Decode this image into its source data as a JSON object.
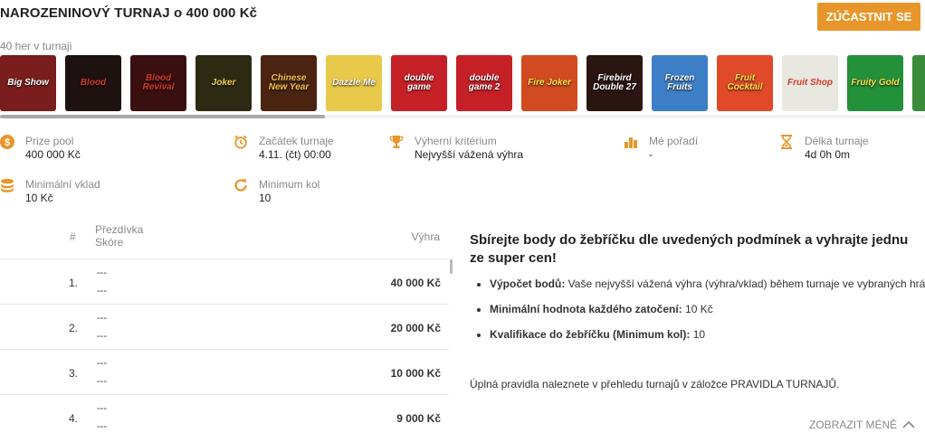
{
  "header": {
    "title": "NAROZENINOVÝ TURNAJ o 400 000 Kč",
    "join_label": "ZÚČASTNIT SE",
    "games_count": "40 her v turnaji"
  },
  "games": [
    {
      "name": "Big Show",
      "color": "#7a1d1d"
    },
    {
      "name": "Blood",
      "color": "#1e1210"
    },
    {
      "name": "Blood Revival",
      "color": "#3a0f10"
    },
    {
      "name": "Joker",
      "color": "#2c2a12"
    },
    {
      "name": "Chinese New Year",
      "color": "#4a2410"
    },
    {
      "name": "Dazzle Me",
      "color": "#e9c94a"
    },
    {
      "name": "double game",
      "color": "#c62027"
    },
    {
      "name": "double game 2",
      "color": "#c62027"
    },
    {
      "name": "Fire Joker",
      "color": "#d24a1f"
    },
    {
      "name": "Firebird Double 27",
      "color": "#2a1510"
    },
    {
      "name": "Frozen Fruits",
      "color": "#3d7fc7"
    },
    {
      "name": "Fruit Cocktail",
      "color": "#e04a28"
    },
    {
      "name": "Fruit Shop",
      "color": "#e8e8e0"
    },
    {
      "name": "Fruity Gold",
      "color": "#23903a"
    },
    {
      "name": "",
      "color": "#3a8c3a"
    }
  ],
  "info": {
    "prize_pool": {
      "label": "Prize pool",
      "value": "400 000 Kč"
    },
    "start": {
      "label": "Začátek turnaje",
      "value": "4.11. (čt) 00:00"
    },
    "criterion": {
      "label": "Výherní kritérium",
      "value": "Nejvyšší vážená výhra"
    },
    "my_rank": {
      "label": "Mé pořadí",
      "value": "-"
    },
    "duration": {
      "label": "Délka turnaje",
      "value": "4d 0h 0m"
    },
    "min_deposit": {
      "label": "Minimální vklad",
      "value": "10 Kč"
    },
    "min_rounds": {
      "label": "Minimum kol",
      "value": "10"
    }
  },
  "table": {
    "col_rank": "#",
    "col_nick": "Přezdívka",
    "col_score": "Skóre",
    "col_prize": "Výhra",
    "rows": [
      {
        "rank": "1.",
        "nick": "---",
        "score": "---",
        "prize": "40 000 Kč"
      },
      {
        "rank": "2.",
        "nick": "---",
        "score": "---",
        "prize": "20 000 Kč"
      },
      {
        "rank": "3.",
        "nick": "---",
        "score": "---",
        "prize": "10 000 Kč"
      },
      {
        "rank": "4.",
        "nick": "---",
        "score": "---",
        "prize": "9 000 Kč"
      }
    ]
  },
  "rules": {
    "title": "Sbírejte body do žebříčku dle uvedených podmínek a vyhrajte jednu ze super cen!",
    "items": [
      {
        "bold": "Výpočet bodů:",
        "text": " Vaše nejvyšší vážená výhra (výhra/vklad) během turnaje ve vybraných hrách"
      },
      {
        "bold": "Minimální hodnota každého zatočení:",
        "text": " 10 Kč"
      },
      {
        "bold": "Kvalifikace do žebříčku (Minimum kol):",
        "text": " 10"
      }
    ],
    "footer": "Úplná pravidla naleznete v přehledu turnajů v záložce PRAVIDLA TURNAJŮ.",
    "show_less": "ZOBRAZIT MÉNĚ"
  },
  "colors": {
    "accent": "#e8962a",
    "icon": "#e8962a"
  }
}
